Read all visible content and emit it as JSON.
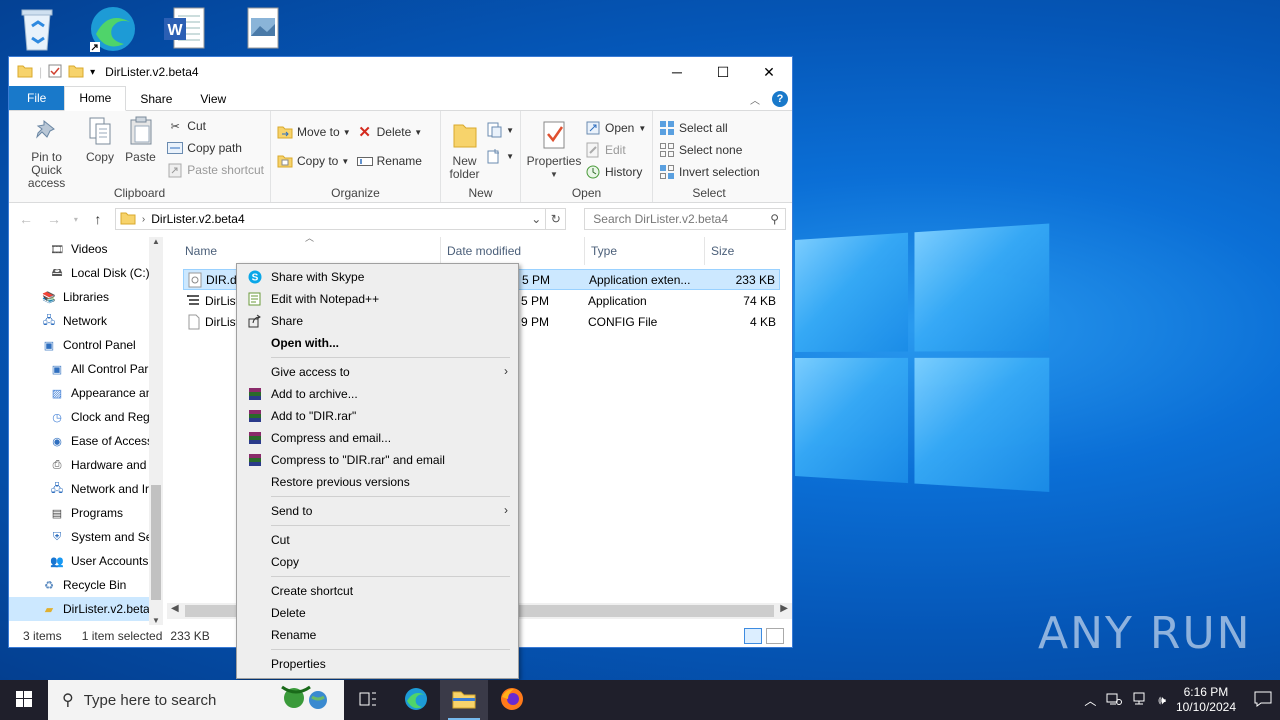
{
  "window": {
    "title": "DirLister.v2.beta4",
    "controls": {
      "minimize": "─",
      "maximize": "☐",
      "close": "✕"
    }
  },
  "ribbon_tabs": [
    "File",
    "Home",
    "Share",
    "View"
  ],
  "help_label": "?",
  "ribbon": {
    "clipboard": {
      "pin": "Pin to Quick access",
      "copy": "Copy",
      "paste": "Paste",
      "cut": "Cut",
      "copy_path": "Copy path",
      "paste_shortcut": "Paste shortcut",
      "group": "Clipboard"
    },
    "organize": {
      "move_to": "Move to",
      "copy_to": "Copy to",
      "delete": "Delete",
      "rename": "Rename",
      "group": "Organize"
    },
    "new": {
      "new_folder_line1": "New",
      "new_folder_line2": "folder",
      "group": "New"
    },
    "open": {
      "properties": "Properties",
      "open": "Open",
      "edit": "Edit",
      "history": "History",
      "group": "Open"
    },
    "select": {
      "select_all": "Select all",
      "select_none": "Select none",
      "invert": "Invert selection",
      "group": "Select"
    }
  },
  "address": {
    "path": "DirLister.v2.beta4",
    "search_placeholder": "Search DirLister.v2.beta4"
  },
  "nav_pane": [
    {
      "label": "Videos",
      "icon": "videos-icon",
      "level": "l2"
    },
    {
      "label": "Local Disk (C:)",
      "icon": "drive-icon",
      "level": "l2"
    },
    {
      "label": "Libraries",
      "icon": "libraries-icon",
      "level": "l1"
    },
    {
      "label": "Network",
      "icon": "network-icon",
      "level": "l1"
    },
    {
      "label": "Control Panel",
      "icon": "control-panel-icon",
      "level": "l1"
    },
    {
      "label": "All Control Par",
      "icon": "control-panel-icon",
      "level": "l2"
    },
    {
      "label": "Appearance an",
      "icon": "appearance-icon",
      "level": "l2"
    },
    {
      "label": "Clock and Regi",
      "icon": "clock-icon",
      "level": "l2"
    },
    {
      "label": "Ease of Access",
      "icon": "ease-of-access-icon",
      "level": "l2"
    },
    {
      "label": "Hardware and",
      "icon": "hardware-icon",
      "level": "l2"
    },
    {
      "label": "Network and Ir",
      "icon": "network-icon",
      "level": "l2"
    },
    {
      "label": "Programs",
      "icon": "programs-icon",
      "level": "l2"
    },
    {
      "label": "System and Sec",
      "icon": "shield-icon",
      "level": "l2"
    },
    {
      "label": "User Accounts",
      "icon": "users-icon",
      "level": "l2"
    },
    {
      "label": "Recycle Bin",
      "icon": "recycle-bin-icon",
      "level": "l1"
    },
    {
      "label": "DirLister.v2.beta4",
      "icon": "folder-icon",
      "level": "l1"
    }
  ],
  "columns": {
    "name": "Name",
    "date": "Date modified",
    "type": "Type",
    "size": "Size"
  },
  "files": [
    {
      "name": "DIR.dll",
      "date": "5 PM",
      "type": "Application exten...",
      "size": "233 KB"
    },
    {
      "name": "DirLister",
      "date": "5 PM",
      "type": "Application",
      "size": "74 KB"
    },
    {
      "name": "DirLister",
      "date": "9 PM",
      "type": "CONFIG File",
      "size": "4 KB"
    }
  ],
  "status": {
    "items": "3 items",
    "selected": "1 item selected",
    "size": "233 KB"
  },
  "context_menu": {
    "share_skype": "Share with Skype",
    "edit_npp": "Edit with Notepad++",
    "share": "Share",
    "open_with": "Open with...",
    "give_access": "Give access to",
    "add_archive": "Add to archive...",
    "add_rar": "Add to \"DIR.rar\"",
    "compress_email": "Compress and email...",
    "compress_rar_email": "Compress to \"DIR.rar\" and email",
    "restore": "Restore previous versions",
    "send_to": "Send to",
    "cut": "Cut",
    "copy": "Copy",
    "create_shortcut": "Create shortcut",
    "delete": "Delete",
    "rename": "Rename",
    "properties": "Properties"
  },
  "taskbar": {
    "search_placeholder": "Type here to search",
    "time": "6:16 PM",
    "date": "10/10/2024"
  },
  "watermark": "ANY RUN",
  "colors": {
    "accent": "#1979ca",
    "selection": "#cce8ff",
    "taskbar": "#1f1f2b"
  }
}
